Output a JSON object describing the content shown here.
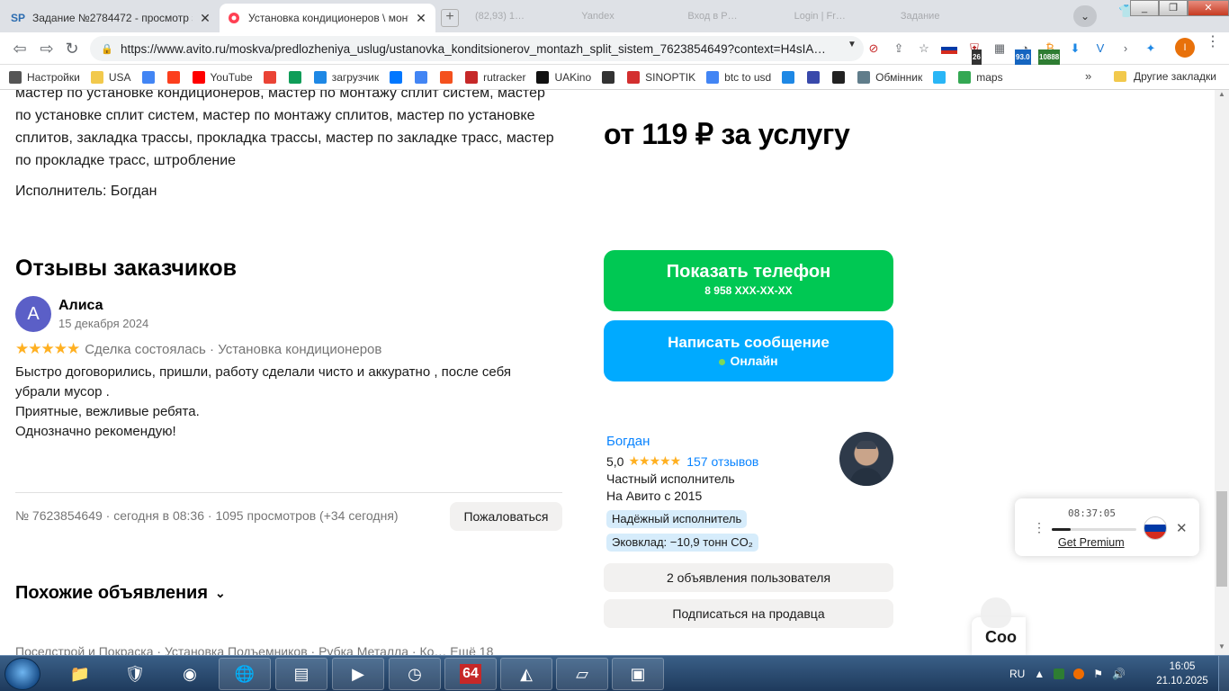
{
  "browser": {
    "tabs": [
      {
        "icon": "SP",
        "title": "Задание №2784472 - просмотр з",
        "active": false
      },
      {
        "icon": "avito",
        "title": "Установка кондиционеров \\ монт",
        "active": true
      }
    ],
    "ghost_tabs": [
      "(82,93) 1…",
      "Yandex",
      "Вход в Р…",
      "Login | Fr…",
      "Задание"
    ],
    "url": "https://www.avito.ru/moskva/predlozheniya_uslug/ustanovka_konditsionerov_montazh_split_sistem_7623854649?context=H4sIA…",
    "ext_badges": {
      "shield": "26",
      "speed": "93.0",
      "counter": "10888"
    },
    "profile_letter": "I",
    "bookmarks": [
      {
        "label": "Настройки",
        "icon": "gear-icon",
        "color": "#555555"
      },
      {
        "label": "USA",
        "icon": "folder-icon",
        "color": "#f2c94c"
      },
      {
        "label": "",
        "icon": "google-icon",
        "color": "#4285f4"
      },
      {
        "label": "",
        "icon": "yandex-icon",
        "color": "#fc3f1d"
      },
      {
        "label": "YouTube",
        "icon": "youtube-icon",
        "color": "#ff0000"
      },
      {
        "label": "",
        "icon": "gmail-icon",
        "color": "#ea4335"
      },
      {
        "label": "",
        "icon": "drive-icon",
        "color": "#0f9d58"
      },
      {
        "label": "загрузчик",
        "icon": "loader-icon",
        "color": "#1e88e5"
      },
      {
        "label": "",
        "icon": "vk-icon",
        "color": "#0077ff"
      },
      {
        "label": "",
        "icon": "translate-icon",
        "color": "#4285f4"
      },
      {
        "label": "",
        "icon": "f-icon",
        "color": "#f4511e"
      },
      {
        "label": "rutracker",
        "icon": "rutracker-icon",
        "color": "#c62828"
      },
      {
        "label": "UAKino",
        "icon": "uakino-icon",
        "color": "#111111"
      },
      {
        "label": "",
        "icon": "chess-icon",
        "color": "#333333"
      },
      {
        "label": "SINOPTIK",
        "icon": "thermometer-icon",
        "color": "#d32f2f"
      },
      {
        "label": "btc to usd",
        "icon": "google-icon",
        "color": "#4285f4"
      },
      {
        "label": "",
        "icon": "p-icon",
        "color": "#1e88e5"
      },
      {
        "label": "",
        "icon": "arrow-icon",
        "color": "#3949ab"
      },
      {
        "label": "",
        "icon": "bc-icon",
        "color": "#222222"
      },
      {
        "label": "Обмінник",
        "icon": "exchange-icon",
        "color": "#607d8b"
      },
      {
        "label": "",
        "icon": "star-icon",
        "color": "#29b6f6"
      },
      {
        "label": "maps",
        "icon": "maps-icon",
        "color": "#34a853"
      }
    ],
    "bookmarks_more": "»",
    "other_bookmarks": "Другие закладки"
  },
  "page": {
    "description": "мастер по установке кондиционеров, мастер по монтажу сплит систем, мастер по установке сплит систем, мастер по монтажу сплитов, мастер по установке сплитов, закладка трассы, прокладка трассы, мастер по закладке трасс, мастер по прокладке трасс, штробление",
    "performer": "Исполнитель: Богдан",
    "price": "от 119 ₽ за услугу",
    "reviews_title": "Отзывы заказчиков",
    "review": {
      "avatar_letter": "А",
      "name": "Алиса",
      "date": "15 декабря 2024",
      "stars": "★★★★★",
      "rating": 5,
      "meta": "Сделка состоялась · Установка кондиционеров",
      "lines": [
        "Быстро договорились, пришли, работу сделали чисто и аккуратно , после себя убрали мусор .",
        "Приятные, вежливые ребята.",
        "Однозначно рекомендую!"
      ]
    },
    "ad_info": "№ 7623854649 · сегодня в 08:36 · 1095 просмотров (+34 сегодня)",
    "report_button": "Пожаловаться",
    "similar_title": "Похожие объявления",
    "similar_row": "Поселстрой и Покраска · Установка Подъемников · Рубка Металла · Ко…    Ещё 18",
    "phone_button": {
      "label": "Показать телефон",
      "number": "8 958 XXX-XX-XX"
    },
    "message_button": {
      "label": "Написать сообщение",
      "status": "Онлайн"
    },
    "seller": {
      "name": "Богдан",
      "rating": "5,0",
      "stars": "★★★★★",
      "reviews_link": "157 отзывов",
      "type": "Частный исполнитель",
      "since": "На Авито с 2015",
      "badges": [
        "Надёжный исполнитель",
        "Эковклад: −10,9 тонн CO₂"
      ]
    },
    "seller_ads_button": "2 объявления пользователя",
    "subscribe_button": "Подписаться на продавца",
    "chat_widget_label": "Соо"
  },
  "popup": {
    "time": "08:37:05",
    "progress": 0.22,
    "link": "Get Premium",
    "flag_colors": [
      "#ffffff",
      "#0039a6",
      "#d52b1e"
    ]
  },
  "taskbar": {
    "apps": [
      "explorer-icon",
      "shield-app-icon",
      "chrome-icon",
      "network-icon",
      "calc-icon",
      "media-icon",
      "clock-app-icon",
      "64-icon",
      "chart-app-icon",
      "notepad-icon",
      "terminal-icon"
    ],
    "lang": "RU",
    "time": "16:05",
    "date": "21.10.2025"
  },
  "colors": {
    "green": "#00c853",
    "blue": "#00aaff",
    "link": "#0a84ff",
    "star": "#ffb021"
  }
}
